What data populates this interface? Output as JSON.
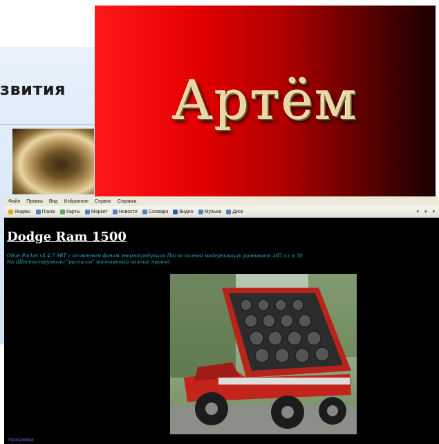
{
  "back_slide": {
    "title_fragment": "звития"
  },
  "title_card": {
    "name": "Артём",
    "colors": {
      "bright": "#ff1a1a",
      "dark": "#1a0000",
      "text": "#e9d8a6"
    }
  },
  "browser": {
    "menu": [
      "Файл",
      "Правка",
      "Вид",
      "Избранное",
      "Сервис",
      "Справка"
    ],
    "toolbar_links": [
      "Яндекс",
      "Поиск",
      "Карты",
      "Маркет",
      "Новости",
      "Словари",
      "Видео",
      "Музыка",
      "Диск"
    ],
    "heading": "Dodge Ram 1500",
    "text_line1": "Один Pocket v8 4.7 SRT с отменным фоном энергопродукции После полной модернизации развивает 465 л.с в 50",
    "text_line2": "На (Шестиструнный) \"расписан\" постоянный полный привод.",
    "text_color": "#1fb3c8",
    "bottom_link": "Программа"
  }
}
